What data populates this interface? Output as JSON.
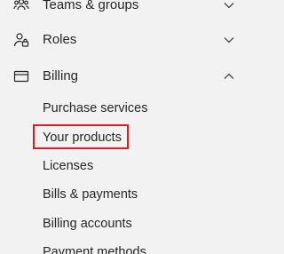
{
  "nav": {
    "teams_groups": {
      "label": "Teams & groups",
      "icon": "teams-icon",
      "expanded": false
    },
    "roles": {
      "label": "Roles",
      "icon": "roles-icon",
      "expanded": false
    },
    "billing": {
      "label": "Billing",
      "icon": "billing-icon",
      "expanded": true,
      "items": [
        {
          "label": "Purchase services"
        },
        {
          "label": "Your products",
          "highlighted": true
        },
        {
          "label": "Licenses"
        },
        {
          "label": "Bills & payments"
        },
        {
          "label": "Billing accounts"
        },
        {
          "label": "Payment methods"
        }
      ]
    }
  },
  "colors": {
    "background": "#f2f2f2",
    "text": "#262626",
    "highlight": "#e01b24"
  }
}
